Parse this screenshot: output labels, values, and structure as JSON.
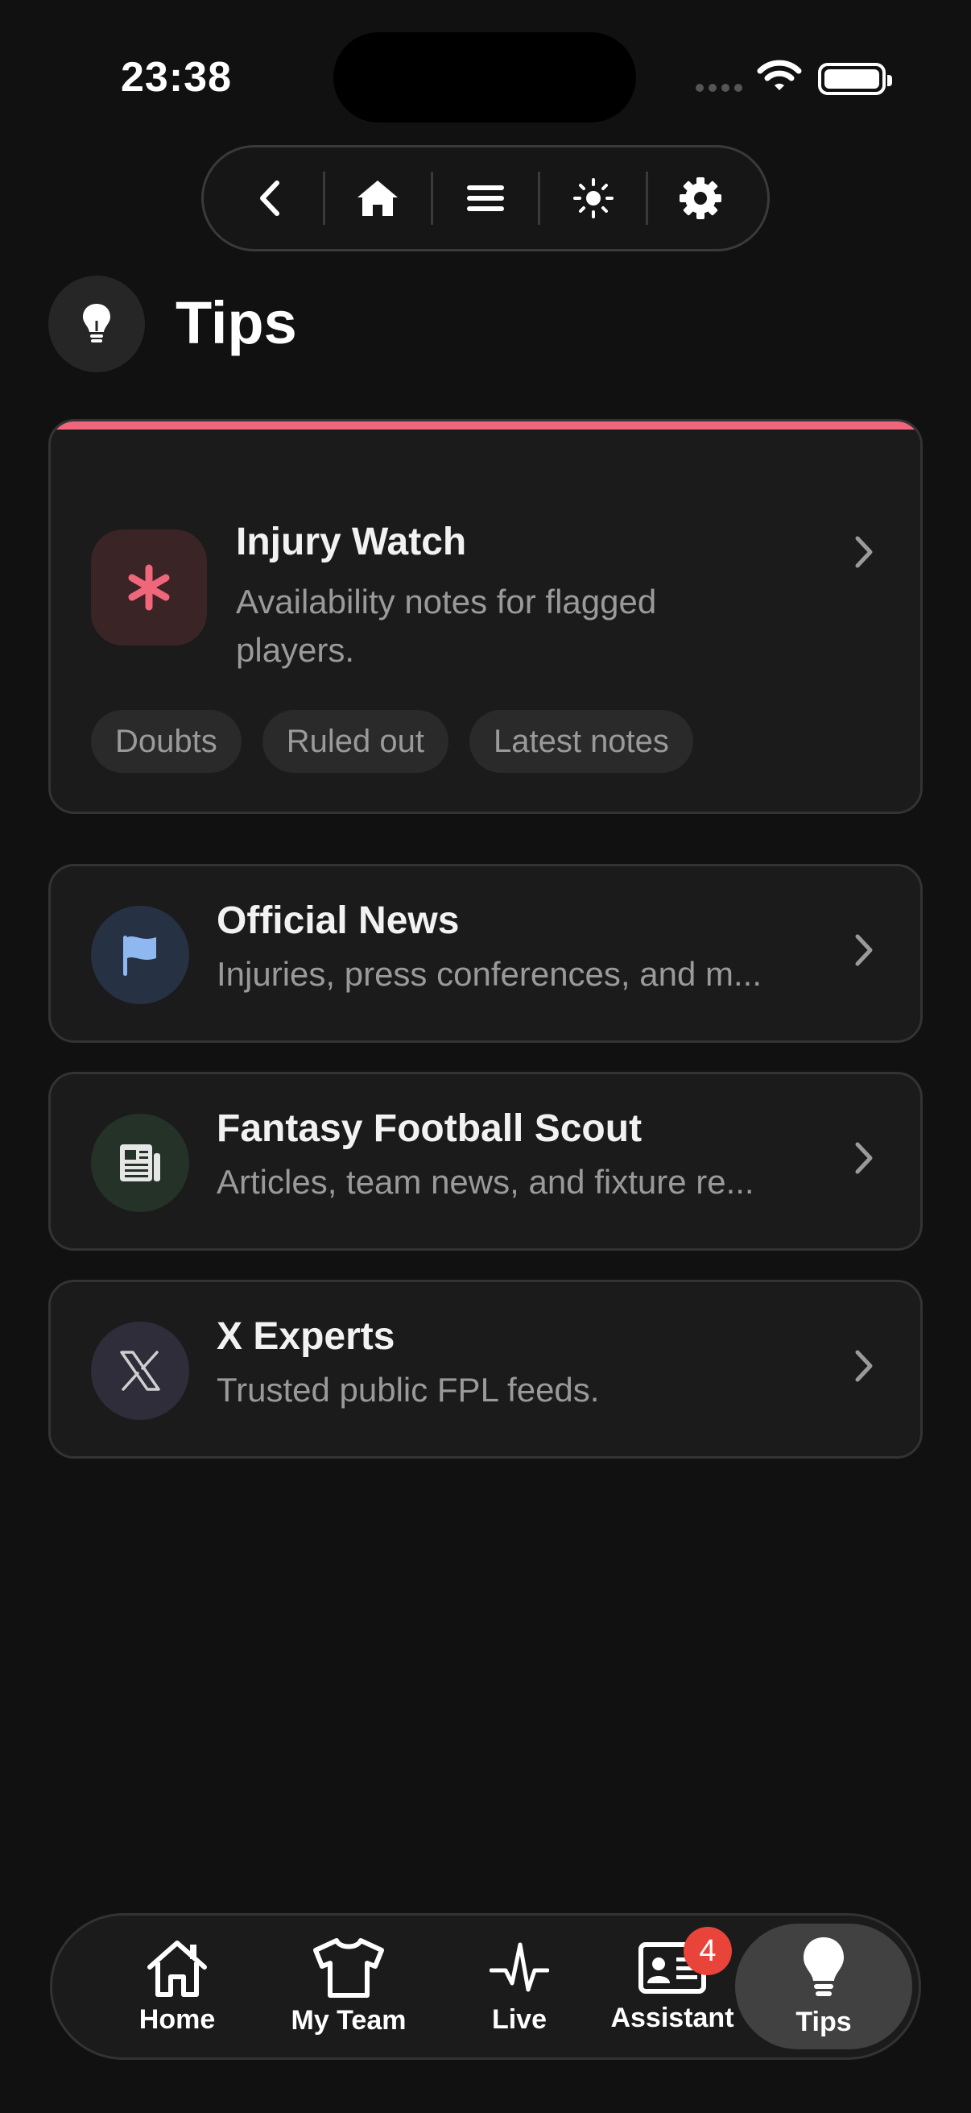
{
  "status_bar": {
    "time": "23:38"
  },
  "toolbar": {
    "buttons": [
      "back-icon",
      "home-icon",
      "menu-icon",
      "brightness-icon",
      "settings-icon"
    ]
  },
  "page": {
    "title": "Tips",
    "icon": "lightbulb-icon"
  },
  "featured": {
    "title": "Injury Watch",
    "description": "Availability notes for flagged players.",
    "icon": "asterisk-icon",
    "accent_color": "#f0667a",
    "chips": [
      "Doubts",
      "Ruled out",
      "Latest notes"
    ]
  },
  "sources": [
    {
      "title": "Official News",
      "description": "Injuries, press conferences, and m...",
      "icon": "flag-icon",
      "icon_bg": "#263244",
      "icon_color": "#8fb8f0"
    },
    {
      "title": "Fantasy Football Scout",
      "description": "Articles, team news, and fixture re...",
      "icon": "newspaper-icon",
      "icon_bg": "#243227",
      "icon_color": "#e6e6e6"
    },
    {
      "title": "X Experts",
      "description": "Trusted public FPL feeds.",
      "icon": "x-logo-icon",
      "icon_bg": "#2f2d3a",
      "icon_color": "#cfcfcf"
    }
  ],
  "tabbar": {
    "tabs": [
      {
        "label": "Home",
        "icon": "house-icon"
      },
      {
        "label": "My Team",
        "icon": "shirt-icon"
      },
      {
        "label": "Live",
        "icon": "pulse-icon"
      },
      {
        "label": "Assistant",
        "icon": "id-card-icon",
        "badge": "4"
      },
      {
        "label": "Tips",
        "icon": "lightbulb-icon",
        "active": true
      }
    ]
  }
}
